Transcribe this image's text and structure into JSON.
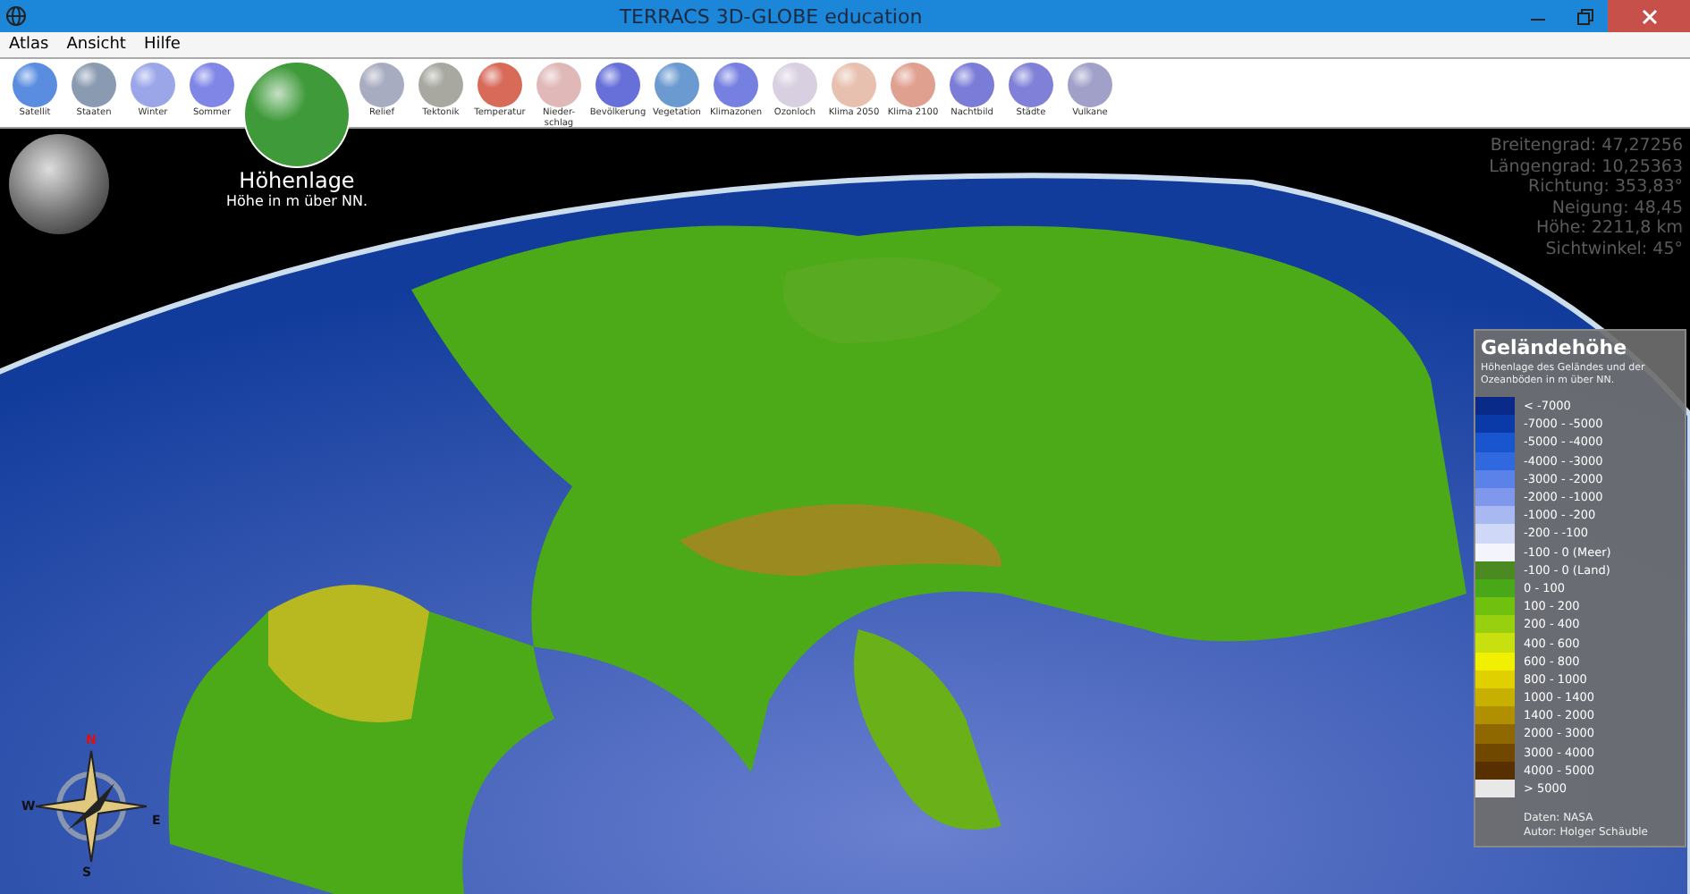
{
  "window": {
    "title": "TERRACS 3D-GLOBE education"
  },
  "menu": [
    "Atlas",
    "Ansicht",
    "Hilfe"
  ],
  "layers": [
    {
      "label": "Satellit",
      "selected": false,
      "color": "#5a8de0"
    },
    {
      "label": "Staaten",
      "selected": false,
      "color": "#8a9ab0"
    },
    {
      "label": "Winter",
      "selected": false,
      "color": "#9aa6e8"
    },
    {
      "label": "Sommer",
      "selected": false,
      "color": "#7f86e6"
    },
    {
      "label": "Höhenlage",
      "selected": true,
      "color": "#3f9a3a"
    },
    {
      "label": "Relief",
      "selected": false,
      "color": "#a8acc0"
    },
    {
      "label": "Tektonik",
      "selected": false,
      "color": "#a8a8a0"
    },
    {
      "label": "Temperatur",
      "selected": false,
      "color": "#d86a5a"
    },
    {
      "label": "Nieder-schlag",
      "selected": false,
      "color": "#e0b8b8"
    },
    {
      "label": "Bevölkerung",
      "selected": false,
      "color": "#6670d8"
    },
    {
      "label": "Vegetation",
      "selected": false,
      "color": "#6a9ad0"
    },
    {
      "label": "Klimazonen",
      "selected": false,
      "color": "#7680e0"
    },
    {
      "label": "Ozonloch",
      "selected": false,
      "color": "#d8d0e0"
    },
    {
      "label": "Klima 2050",
      "selected": false,
      "color": "#e8c0b0"
    },
    {
      "label": "Klima 2100",
      "selected": false,
      "color": "#e0a090"
    },
    {
      "label": "Nachtbild",
      "selected": false,
      "color": "#7a7cd8"
    },
    {
      "label": "Städte",
      "selected": false,
      "color": "#8080d8"
    },
    {
      "label": "Vulkane",
      "selected": false,
      "color": "#a0a0c8"
    }
  ],
  "selected_layer": {
    "subtitle": "Höhe in m über NN."
  },
  "info": [
    "Breitengrad: 47,27256",
    "Längengrad: 10,25363",
    "Richtung: 353,83°",
    "Neigung: 48,45",
    "Höhe: 2211,8 km",
    "Sichtwinkel: 45°"
  ],
  "legend": {
    "title": "Geländehöhe",
    "subtitle": "Höhenlage des Geländes und der Ozeanböden in m über NN.",
    "entries": [
      {
        "label": "< -7000",
        "color": "#0a2a8a"
      },
      {
        "label": "-7000 - -5000",
        "color": "#0a3aa8"
      },
      {
        "label": "-5000 - -4000",
        "color": "#1a55d0"
      },
      {
        "label": "-4000 - -3000",
        "color": "#3068e0"
      },
      {
        "label": "-3000 - -2000",
        "color": "#5a82e8"
      },
      {
        "label": "-2000 - -1000",
        "color": "#8098ec"
      },
      {
        "label": "-1000 - -200",
        "color": "#a8b8f0"
      },
      {
        "label": "-200 - -100",
        "color": "#d0d8f8"
      },
      {
        "label": "-100 - 0 (Meer)",
        "color": "#f4f4fc"
      },
      {
        "label": "-100 - 0 (Land)",
        "color": "#4a8a20"
      },
      {
        "label": "0 - 100",
        "color": "#48a818"
      },
      {
        "label": "100 - 200",
        "color": "#70c010"
      },
      {
        "label": "200 - 400",
        "color": "#98d010"
      },
      {
        "label": "400 - 600",
        "color": "#c8e010"
      },
      {
        "label": "600 - 800",
        "color": "#f0f000"
      },
      {
        "label": "800 - 1000",
        "color": "#e0d000"
      },
      {
        "label": "1000 - 1400",
        "color": "#c8b000"
      },
      {
        "label": "1400 - 2000",
        "color": "#b09000"
      },
      {
        "label": "2000 - 3000",
        "color": "#906800"
      },
      {
        "label": "3000 - 4000",
        "color": "#704800"
      },
      {
        "label": "4000 - 5000",
        "color": "#583000"
      },
      {
        "label": "> 5000",
        "color": "#e8e8e8"
      }
    ],
    "footer": [
      "Daten: NASA",
      "Autor: Holger Schäuble"
    ]
  },
  "compass": [
    "N",
    "W",
    "E",
    "S"
  ]
}
